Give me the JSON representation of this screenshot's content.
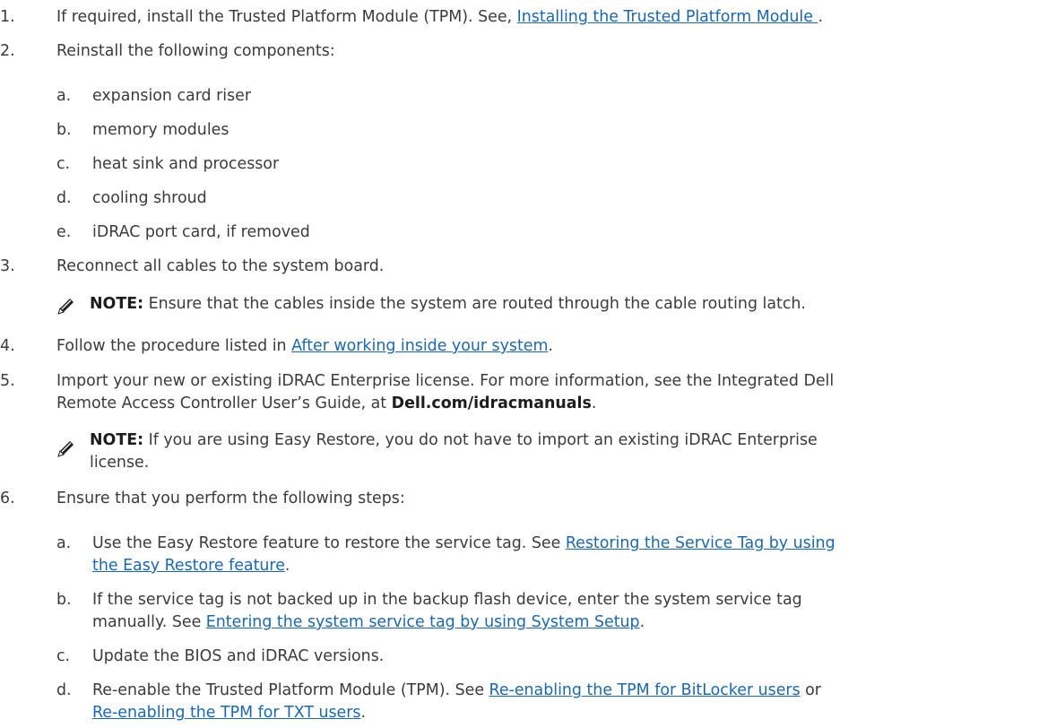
{
  "steps": [
    {
      "n": "1.",
      "pre": "If required, install the Trusted Platform Module (TPM). See, ",
      "link": "Installing the Trusted Platform Module ",
      "post": "."
    },
    {
      "n": "2.",
      "text": "Reinstall the following components:"
    },
    {
      "n": "3.",
      "text": "Reconnect all cables to the system board."
    },
    {
      "n": "4.",
      "pre": "Follow the procedure listed in ",
      "link": "After working inside your system",
      "post": "."
    },
    {
      "n": "5.",
      "line1": "Import your new or existing iDRAC Enterprise license. For more information, see the Integrated Dell",
      "line2_pre": "Remote Access Controller User’s Guide, at ",
      "line2_bold": "Dell.com/idracmanuals",
      "line2_post": "."
    },
    {
      "n": "6.",
      "text": "Ensure that you perform the following steps:"
    }
  ],
  "components": [
    {
      "n": "a.",
      "text": "expansion card riser"
    },
    {
      "n": "b.",
      "text": "memory modules"
    },
    {
      "n": "c.",
      "text": "heat sink and processor"
    },
    {
      "n": "d.",
      "text": "cooling shroud"
    },
    {
      "n": "e.",
      "text": "iDRAC port card, if removed"
    }
  ],
  "notes": [
    {
      "label": "NOTE:",
      "text": " Ensure that the cables inside the system are routed through the cable routing latch."
    },
    {
      "label": "NOTE:",
      "line1": " If you are using Easy Restore, you do not have to import an existing iDRAC Enterprise",
      "line2": "license."
    }
  ],
  "substeps": [
    {
      "n": "a.",
      "pre": "Use the Easy Restore feature to restore the service tag. See ",
      "link1": "Restoring the Service Tag by using",
      "link2": "the Easy Restore feature",
      "post": "."
    },
    {
      "n": "b.",
      "line1": "If the service tag is not backed up in the backup flash device, enter the system service tag",
      "line2_pre": "manually. See ",
      "link": "Entering the system service tag by using System Setup",
      "post": "."
    },
    {
      "n": "c.",
      "text": "Update the BIOS and iDRAC versions."
    },
    {
      "n": "d.",
      "pre": "Re-enable the Trusted Platform Module (TPM). See ",
      "link1": "Re-enabling the TPM for BitLocker users",
      "mid": " or",
      "link2": "Re-enabling the TPM for TXT users",
      "post": "."
    }
  ],
  "icons": {
    "note": "note-pencil-icon"
  }
}
